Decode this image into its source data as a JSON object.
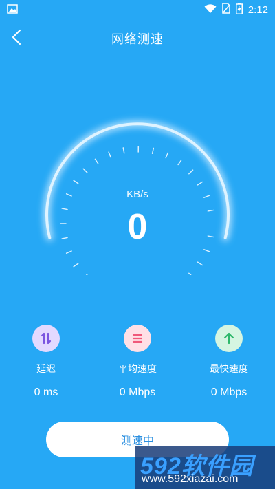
{
  "status_bar": {
    "time": "2:12"
  },
  "header": {
    "title": "网络测速"
  },
  "gauge": {
    "unit": "KB/s",
    "value": "0"
  },
  "stats": [
    {
      "label": "延迟",
      "value": "0 ms",
      "icon": "latency-arrows-icon",
      "bg": "#e3d9ff",
      "fg": "#7b55e0"
    },
    {
      "label": "平均速度",
      "value": "0 Mbps",
      "icon": "average-lines-icon",
      "bg": "#ffe0e6",
      "fg": "#f0587a"
    },
    {
      "label": "最快速度",
      "value": "0 Mbps",
      "icon": "arrow-up-icon",
      "bg": "#d5f5e1",
      "fg": "#2eb86b"
    }
  ],
  "button": {
    "label": "测速中"
  },
  "watermark": {
    "brand": "592软件园",
    "url": "www.592xiazai.com"
  },
  "colors": {
    "background": "#26a8f5",
    "button_text": "#2a8fe0"
  }
}
